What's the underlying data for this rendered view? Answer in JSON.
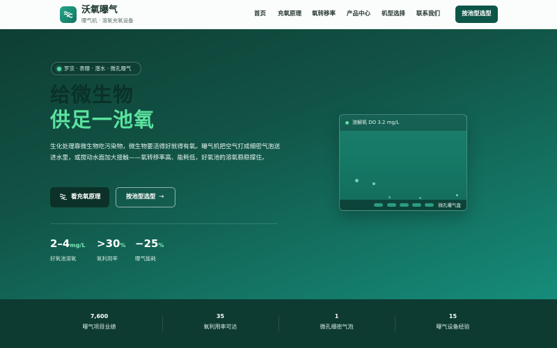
{
  "brand": {
    "name": "沃氧曝气",
    "subtitle": "曝气机 · 溶氧充氧设备"
  },
  "nav": {
    "items": [
      "首页",
      "充氧原理",
      "氧转移率",
      "产品中心",
      "机型选择",
      "联系我们"
    ],
    "cta": "按池型选型"
  },
  "hero": {
    "tag": "罗茨 · 表曝 · 潜水 · 微孔曝气",
    "title_line1": "给微生物",
    "title_line2": "供足一池氧",
    "description": "生化处理靠微生物吃污染物，微生物要活得好就得有氧。曝气机把空气打成细密气泡送进水里，或搅动水面加大接触——氧转移率高、能耗低，好氧池的溶氧稳稳撑住。",
    "btn_primary": "看充氧原理",
    "btn_secondary": "按池型选型",
    "btn_secondary_arrow": "→",
    "stats": [
      {
        "value": "2–4",
        "unit": "mg/L",
        "label": "好氧池溶氧"
      },
      {
        "value": ">30",
        "unit": "%",
        "label": "氧利用率"
      },
      {
        "value": "−25",
        "unit": "%",
        "label": "曝气能耗"
      }
    ]
  },
  "card": {
    "title": "溶解氧 DO 3.2 mg/L",
    "footer": "微孔曝气盘"
  },
  "band": [
    {
      "number": "7,600",
      "label": "曝气项目业绩"
    },
    {
      "number": "35",
      "label": "氧利用率可达"
    },
    {
      "number": "1",
      "label": "微孔细密气泡"
    },
    {
      "number": "15",
      "label": "曝气设备经验"
    }
  ],
  "colors": {
    "accent": "#5be39f",
    "brand_dark": "#0d5546",
    "hero_dark": "#0f3e34",
    "hero_light": "#168c7a"
  },
  "icons": {
    "logo": "aeration-waves-icon",
    "primary_button": "aeration-waves-icon",
    "card_status": "status-dot-icon"
  }
}
